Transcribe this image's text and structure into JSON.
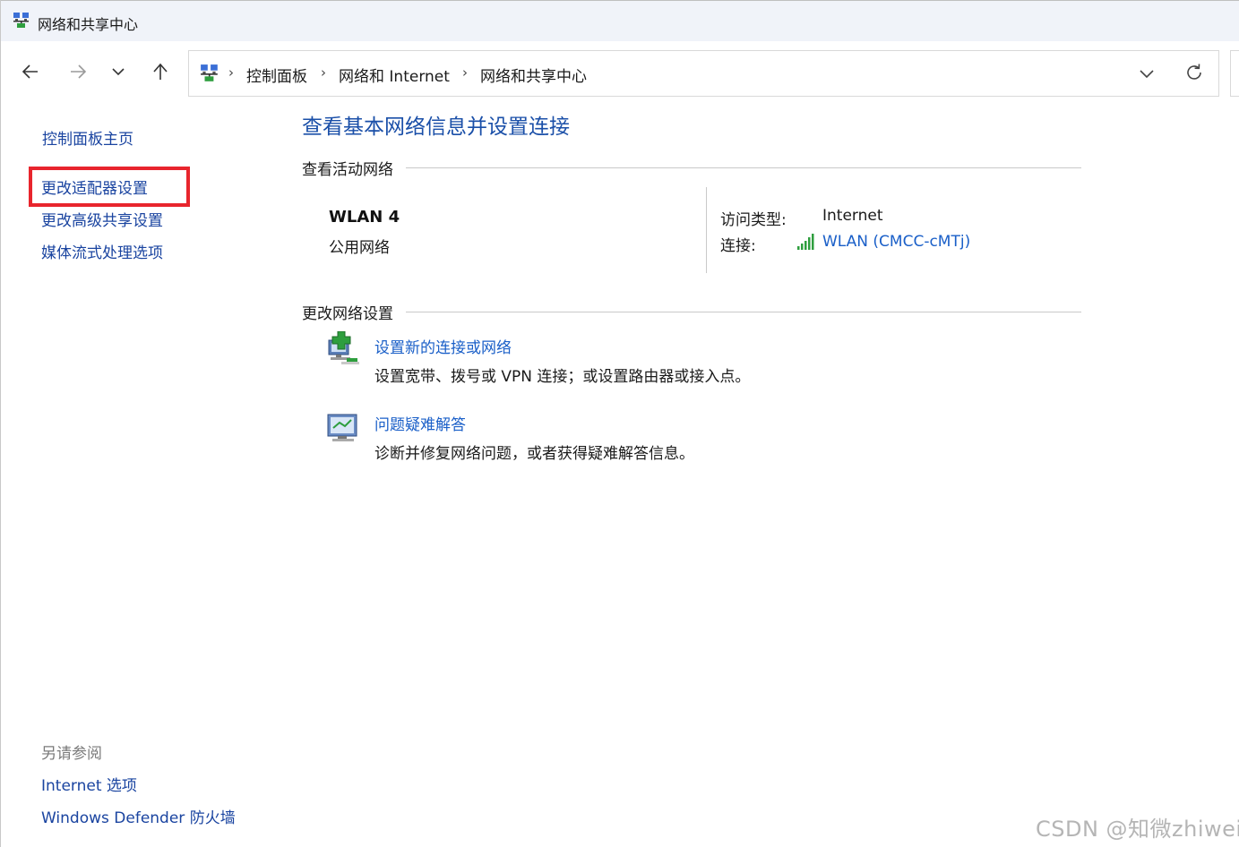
{
  "window": {
    "title": "网络和共享中心"
  },
  "address_bar": {
    "crumbs": [
      "控制面板",
      "网络和 Internet",
      "网络和共享中心"
    ],
    "separator": "›"
  },
  "sidebar": {
    "home": "控制面板主页",
    "items": [
      "更改适配器设置",
      "更改高级共享设置",
      "媒体流式处理选项"
    ],
    "highlight_color": "#e8252d",
    "see_also_label": "另请参阅",
    "see_also": [
      "Internet 选项",
      "Windows Defender 防火墙"
    ]
  },
  "main": {
    "title": "查看基本网络信息并设置连接",
    "active_networks_label": "查看活动网络",
    "network": {
      "name": "WLAN 4",
      "category": "公用网络",
      "access_type_label": "访问类型:",
      "access_type_value": "Internet",
      "connection_label": "连接:",
      "connection_value": "WLAN (CMCC-cMTj)"
    },
    "change_settings_label": "更改网络设置",
    "tasks": [
      {
        "link": "设置新的连接或网络",
        "desc": "设置宽带、拨号或 VPN 连接；或设置路由器或接入点。",
        "icon": "new-connection-icon"
      },
      {
        "link": "问题疑难解答",
        "desc": "诊断并修复网络问题，或者获得疑难解答信息。",
        "icon": "troubleshoot-icon"
      }
    ]
  },
  "watermark": "CSDN @知微zhiwei",
  "colors": {
    "link": "#1a5fc8",
    "title": "#1a4fa8",
    "titlebar_bg": "#f0f3f9"
  }
}
